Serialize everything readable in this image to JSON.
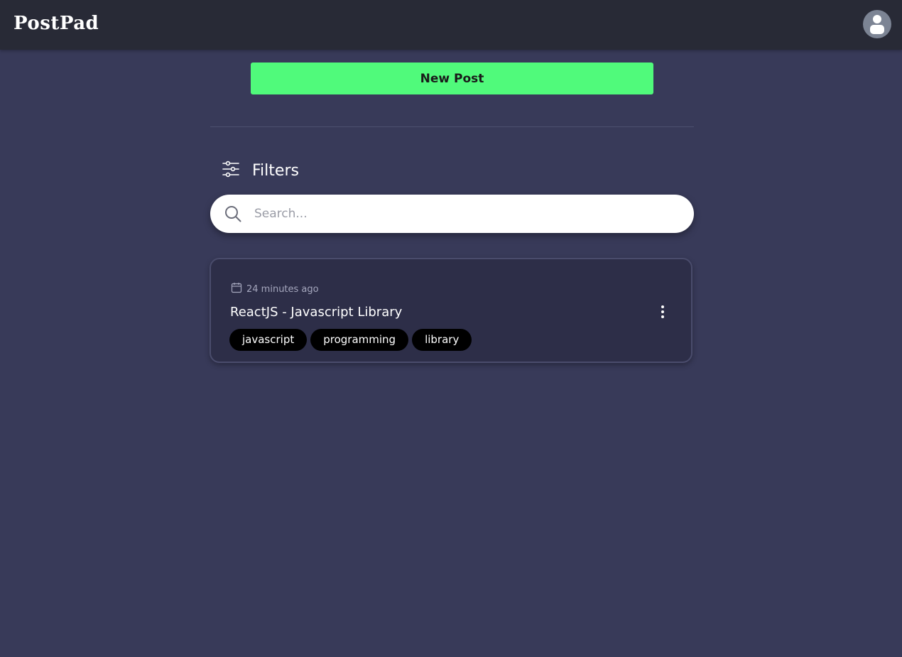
{
  "app": {
    "logo": "PostPad"
  },
  "actions": {
    "new_post_label": "New Post"
  },
  "filters": {
    "label": "Filters"
  },
  "search": {
    "placeholder": "Search..."
  },
  "posts": [
    {
      "date": "24 minutes ago",
      "title": "ReactJS - Javascript Library",
      "tags": [
        "javascript",
        "programming",
        "library"
      ]
    }
  ],
  "colors": {
    "background": "#383a59",
    "navbar": "#282a36",
    "accent": "#50fa7b",
    "card": "#2d2e48",
    "tag": "#000000"
  },
  "icons": {
    "avatar": "user-avatar-icon",
    "filters": "sliders-icon",
    "search": "search-icon",
    "date": "calendar-icon",
    "more": "more-vertical-icon"
  }
}
